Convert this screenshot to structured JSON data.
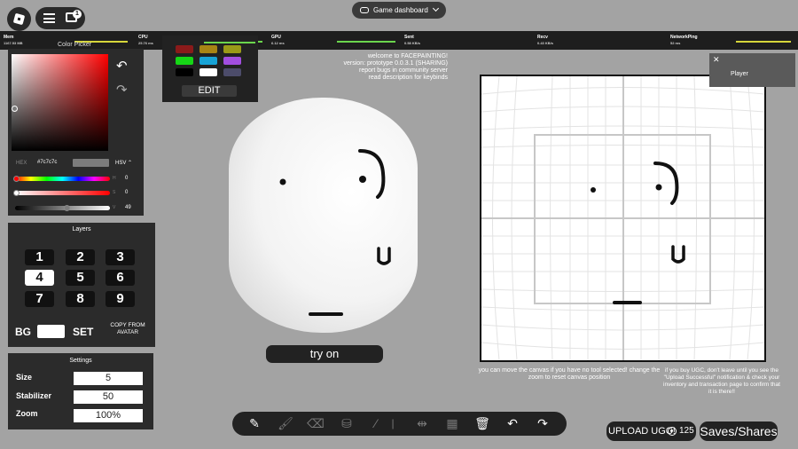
{
  "topbar": {
    "menu_badge": "1",
    "dashboard_label": "Game dashboard"
  },
  "stats": [
    {
      "name": "Mem",
      "value": "1167.53 MB",
      "bar": "#d6d63a"
    },
    {
      "name": "CPU",
      "value": "25.76 ms",
      "bar": "#6bd64d"
    },
    {
      "name": "GPU",
      "value": "6.12 ms",
      "bar": "#6bd64d"
    },
    {
      "name": "Sent",
      "value": "0.58 KB/s",
      "bar": ""
    },
    {
      "name": "Recv",
      "value": "0.43 KB/s",
      "bar": ""
    },
    {
      "name": "NetworkPing",
      "value": "52 ms",
      "bar": "#d6d63a"
    }
  ],
  "color_picker": {
    "title": "Color Picker",
    "hex_label": "HEX",
    "hex_value": "#7c7c7c",
    "mode": "HSV",
    "h_label": "H",
    "s_label": "S",
    "v_label": "V",
    "hue": "0",
    "saturation": "0",
    "value": "49"
  },
  "palette": {
    "colors": [
      "#8b1a1a",
      "#a88414",
      "#9a9a18",
      "#16d616",
      "#17a3d6",
      "#a24ee0",
      "#000000",
      "#ffffff",
      "#4c4c6a"
    ],
    "edit_label": "EDIT"
  },
  "welcome": {
    "line1": "welcome to FACEPAINTING!",
    "line2": "version: prototype 0.0.3.1 (SHARING)",
    "line3": "report bugs in community server",
    "line4": "read description for keybinds"
  },
  "layers": {
    "title": "Layers",
    "keys": [
      "1",
      "2",
      "3",
      "4",
      "5",
      "6",
      "7",
      "8",
      "9"
    ],
    "active": "4",
    "bg_label": "BG",
    "set_label": "SET",
    "copy_label": "COPY FROM AVATAR"
  },
  "settings": {
    "title": "Settings",
    "size_label": "Size",
    "size_value": "5",
    "stabilizer_label": "Stabilizer",
    "stabilizer_value": "50",
    "zoom_label": "Zoom",
    "zoom_value": "100%"
  },
  "tryon_label": "try on",
  "player_panel": {
    "close": "✕",
    "label": "Player"
  },
  "notes": {
    "left": "you can move the canvas if you have no tool selected! change the zoom to reset canvas position",
    "right": "if you buy UGC, don't leave until you see the \"Upload Successful\" notification & check your inventory and transaction page to confirm that it is there!!"
  },
  "toolbar": {
    "tools": [
      "pencil-icon",
      "brush-icon",
      "eraser-icon",
      "fill-bucket-icon",
      "eyedropper-icon",
      "mirror-icon",
      "canvas-icon",
      "trash-icon",
      "undo-icon",
      "redo-icon"
    ]
  },
  "upload": {
    "label": "UPLOAD UGC!",
    "price": "125"
  },
  "saves_label": "Saves/Shares"
}
